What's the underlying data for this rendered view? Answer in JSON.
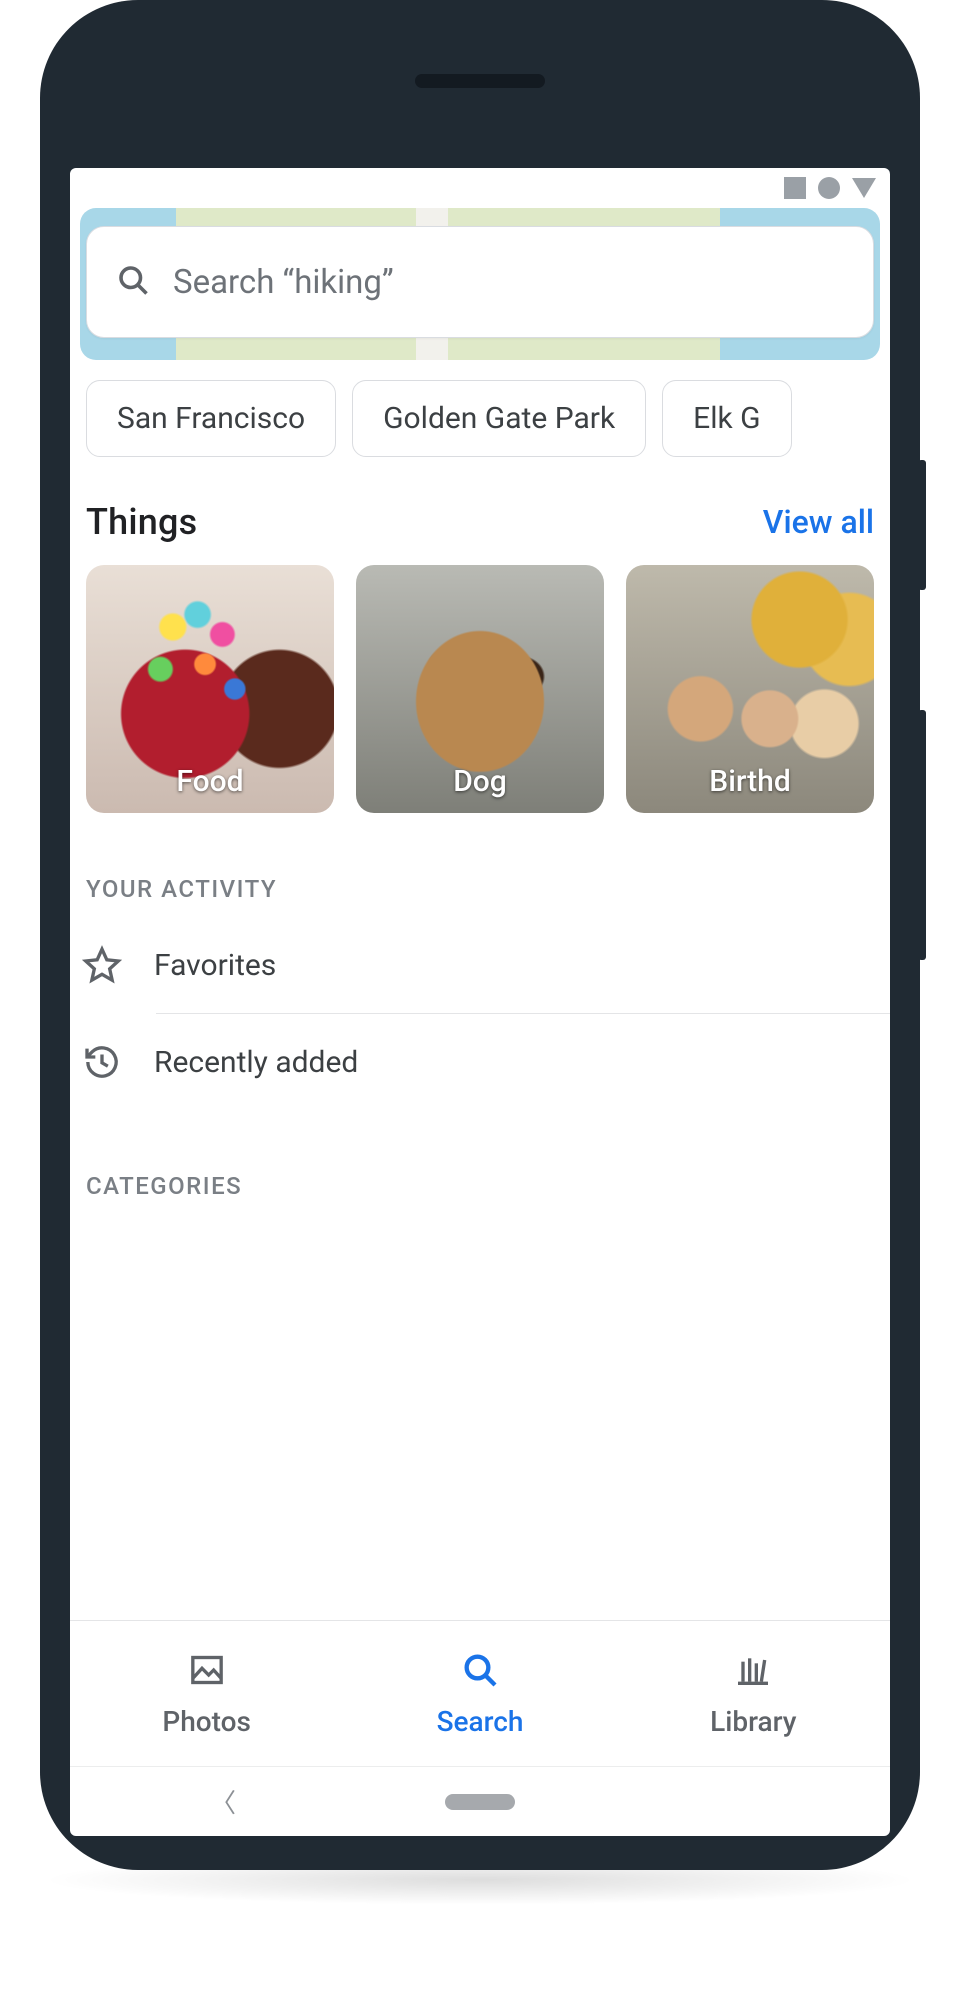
{
  "search": {
    "placeholder": "Search “hiking”"
  },
  "chips": [
    "San Francisco",
    "Golden Gate Park",
    "Elk G"
  ],
  "things": {
    "title": "Things",
    "view_all": "View all",
    "items": [
      {
        "label": "Food"
      },
      {
        "label": "Dog"
      },
      {
        "label": "Birthd"
      }
    ]
  },
  "activity": {
    "header": "YOUR ACTIVITY",
    "favorites": "Favorites",
    "recently_added": "Recently added"
  },
  "categories": {
    "header": "CATEGORIES"
  },
  "nav": {
    "photos": "Photos",
    "search": "Search",
    "library": "Library"
  }
}
